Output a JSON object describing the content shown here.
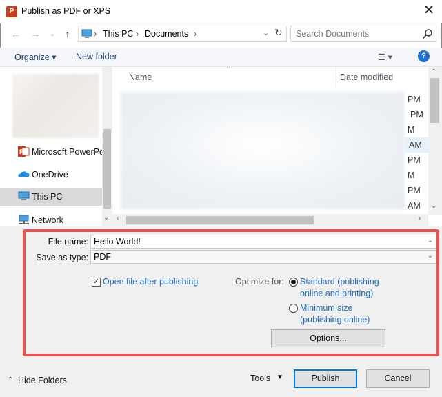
{
  "window": {
    "title": "Publish as PDF or XPS",
    "app_icon_letter": "P",
    "close_glyph": "✕"
  },
  "nav": {
    "back_glyph": "←",
    "forward_glyph": "→",
    "recent_glyph": "⌄",
    "up_glyph": "↑"
  },
  "address": {
    "crumbs": [
      "This PC",
      "Documents"
    ],
    "separator": "›",
    "dropdown_glyph": "⌄",
    "refresh_glyph": "↻"
  },
  "search": {
    "placeholder": "Search Documents"
  },
  "toolbar": {
    "organize_label": "Organize ▾",
    "new_folder_label": "New folder",
    "view_glyph": "☰ ▾",
    "help_glyph": "?"
  },
  "sidebar": {
    "items": [
      {
        "label": "Microsoft PowerPo",
        "icon": "powerpoint-icon"
      },
      {
        "label": "OneDrive",
        "icon": "onedrive-icon"
      },
      {
        "label": "This PC",
        "icon": "this-pc-icon",
        "selected": true
      },
      {
        "label": "Network",
        "icon": "network-icon"
      }
    ]
  },
  "file_list": {
    "columns": [
      "Name",
      "Date modified"
    ],
    "time_fragments": [
      "PM",
      "PM",
      "M",
      "AM",
      "PM",
      "M",
      "PM",
      "AM"
    ]
  },
  "form": {
    "file_name_label": "File name:",
    "file_name_value": "Hello World!",
    "save_type_label": "Save as type:",
    "save_type_value": "PDF",
    "open_after_label": "Open file after publishing",
    "open_after_checked": true,
    "optimize_label": "Optimize for:",
    "opt_standard_line1": "Standard (publishing",
    "opt_standard_line2": "online and printing)",
    "opt_minimum_line1": "Minimum size",
    "opt_minimum_line2": "(publishing online)",
    "options_button": "Options...",
    "selected_optimize": "standard"
  },
  "footer": {
    "hide_folders": "Hide Folders",
    "tools": "Tools",
    "publish": "Publish",
    "cancel": "Cancel"
  },
  "colors": {
    "highlight": "#e8534f",
    "link": "#1f6bc2",
    "accent": "#0078d7"
  }
}
